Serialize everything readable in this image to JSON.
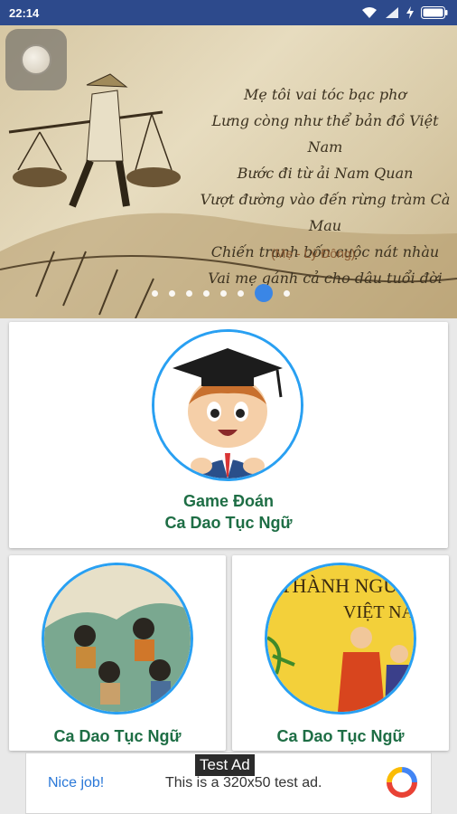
{
  "status_bar": {
    "time": "22:14"
  },
  "banner": {
    "poem_lines": [
      "Mẹ tôi vai tóc bạc phơ",
      "Lưng còng như thể bản đồ Việt Nam",
      "Bước đi từ ải Nam Quan",
      "Vượt đường vào đến rừng tràm Cà Mau",
      "Chiến tranh bốn cuộc nát nhàu",
      "Vai mẹ gánh cả cho dâu tuổi đời"
    ],
    "author": "(Mẹ - Lý Đông)",
    "slide_count": 8,
    "active_slide": 7
  },
  "cards": [
    {
      "title_line1": "Game Đoán",
      "title_line2": "Ca Dao Tục Ngữ"
    },
    {
      "title_line1": "Ca Dao Tục Ngữ"
    },
    {
      "title_line1": "Ca Dao Tục Ngữ",
      "image_text_line1": "THÀNH NGỮ",
      "image_text_line2": "VIỆT NA"
    }
  ],
  "ad": {
    "label": "Test Ad",
    "nice_job": "Nice job!",
    "text": "This is a 320x50 test ad."
  },
  "colors": {
    "accent": "#29a0f2",
    "title_green": "#1e6e45",
    "status_bar": "#2d4a8c"
  }
}
